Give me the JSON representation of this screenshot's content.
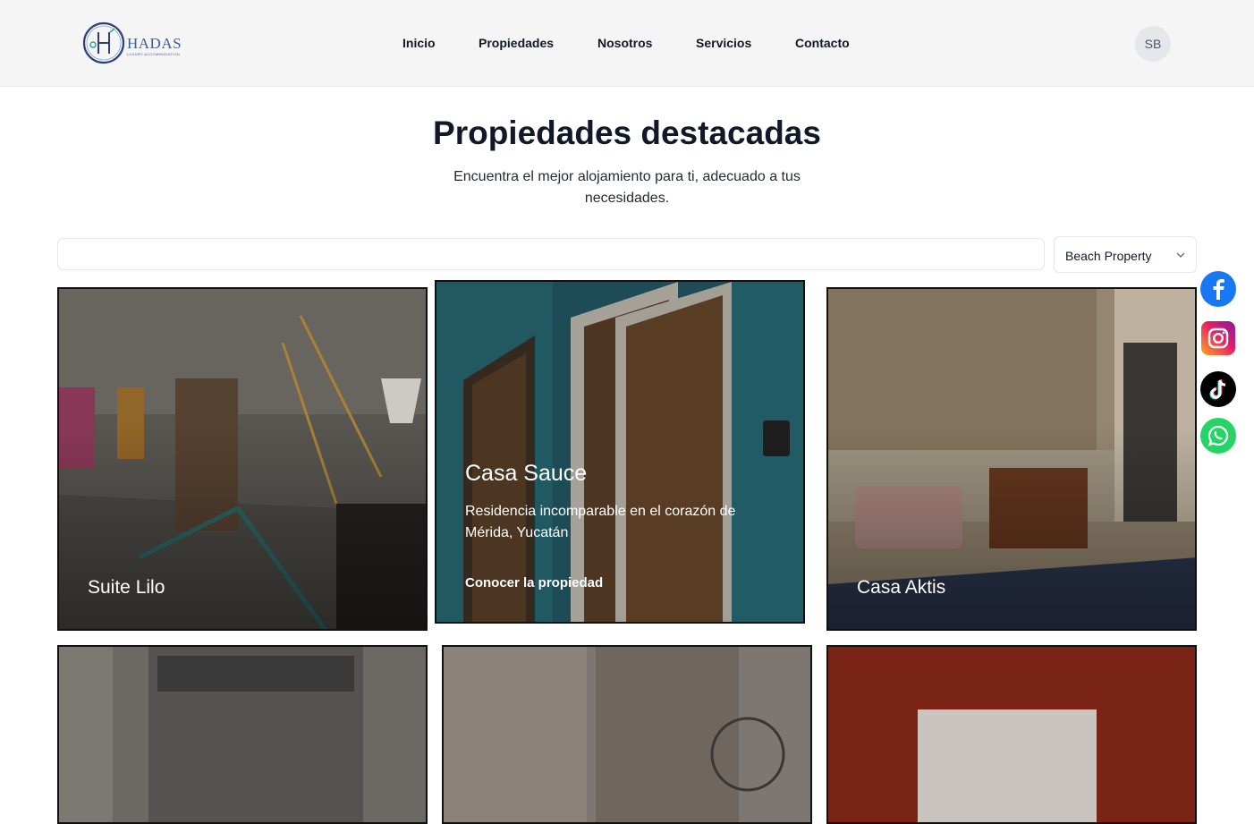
{
  "brand": {
    "name": "HADAS",
    "tagline": "LUXURY ACCOMMODATION"
  },
  "nav": [
    {
      "label": "Inicio"
    },
    {
      "label": "Propiedades"
    },
    {
      "label": "Nosotros"
    },
    {
      "label": "Servicios"
    },
    {
      "label": "Contacto"
    }
  ],
  "user": {
    "initials": "SB"
  },
  "hero": {
    "title": "Propiedades destacadas",
    "subtitle": "Encuentra el mejor alojamiento para ti, adecuado a tus necesidades."
  },
  "search": {
    "value": "",
    "placeholder": ""
  },
  "filter": {
    "selected": "Beach Property"
  },
  "properties": [
    {
      "name": "Suite Lilo"
    },
    {
      "name": "Casa Sauce",
      "description": "Residencia incomparable en el corazón de Mérida, Yucatán",
      "cta": "Conocer la propiedad"
    },
    {
      "name": "Casa Aktis"
    },
    {
      "name": ""
    },
    {
      "name": ""
    },
    {
      "name": ""
    }
  ],
  "social": [
    "facebook-icon",
    "instagram-icon",
    "tiktok-icon",
    "whatsapp-icon"
  ],
  "colors": {
    "facebook": "#1877f2",
    "tiktok": "#000000",
    "whatsapp": "#25d366",
    "brand": "#3b5ea8"
  }
}
